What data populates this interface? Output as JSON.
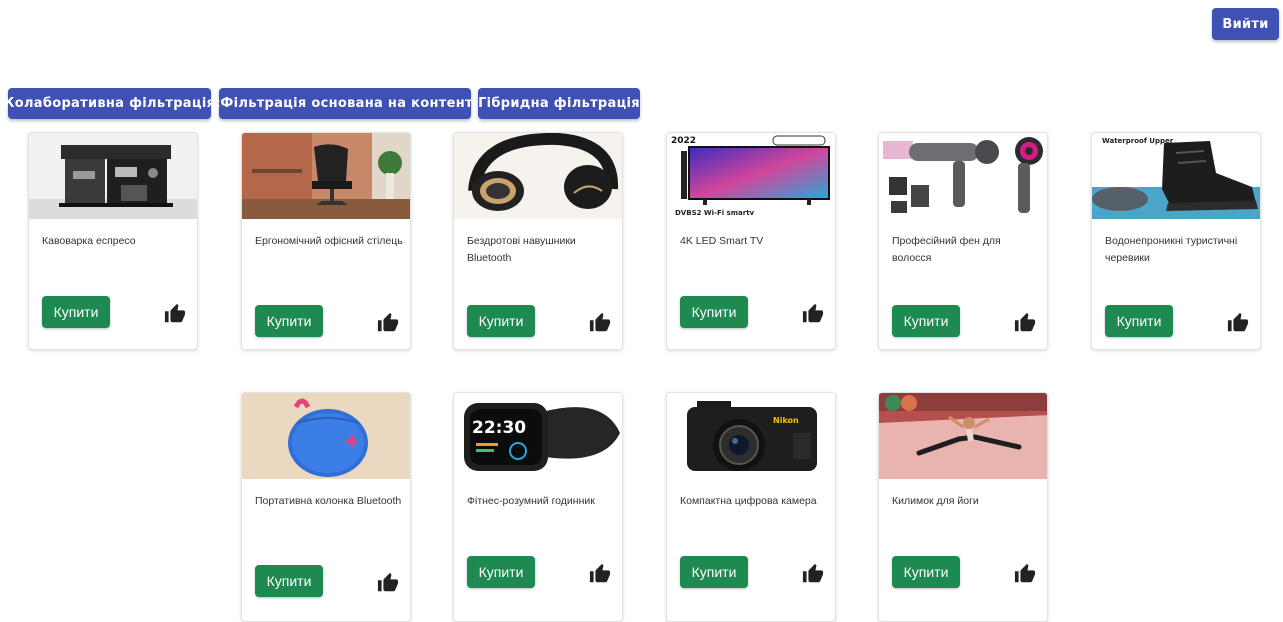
{
  "header": {
    "logout_label": "Вийти"
  },
  "filters": [
    {
      "label": "Колаборативна фільтрація"
    },
    {
      "label": "сФільтрація основана на контенті"
    },
    {
      "label": "Гібридна фільтрація"
    }
  ],
  "products": [
    {
      "name": "Кавоварка еспресо",
      "buy_label": "Купити",
      "thumb_icon": "coffee-machine-icon"
    },
    {
      "name": "Ергономічний офісний стілець",
      "buy_label": "Купити",
      "thumb_icon": "office-chair-icon"
    },
    {
      "name": "Бездротові навушники Bluetooth",
      "buy_label": "Купити",
      "thumb_icon": "headphones-icon"
    },
    {
      "name": "4K LED Smart TV",
      "buy_label": "Купити",
      "thumb_icon": "tv-icon",
      "thumb_text": {
        "year": "2022",
        "bottom": "DVBS2 Wi-Fi smartv"
      }
    },
    {
      "name": "Професійний фен для волосся",
      "buy_label": "Купити",
      "thumb_icon": "hair-dryer-icon"
    },
    {
      "name": "Водонепроникні туристичні черевики",
      "buy_label": "Купити",
      "thumb_icon": "hiking-boot-icon",
      "thumb_text": {
        "top": "Waterproof Upper"
      }
    },
    {
      "name": "Портативна колонка Bluetooth",
      "buy_label": "Купити",
      "thumb_icon": "speaker-icon"
    },
    {
      "name": "Фітнес-розумний годинник",
      "buy_label": "Купити",
      "thumb_icon": "smartwatch-icon",
      "thumb_text": {
        "time": "22:30"
      }
    },
    {
      "name": "Компактна цифрова камера",
      "buy_label": "Купити",
      "thumb_icon": "camera-icon",
      "thumb_text": {
        "brand": "Nikon"
      }
    },
    {
      "name": "Килимок для йоги",
      "buy_label": "Купити",
      "thumb_icon": "yoga-mat-icon"
    }
  ],
  "colors": {
    "primary": "#3f51b5",
    "buy": "#1e8a52",
    "like": "#222222"
  }
}
